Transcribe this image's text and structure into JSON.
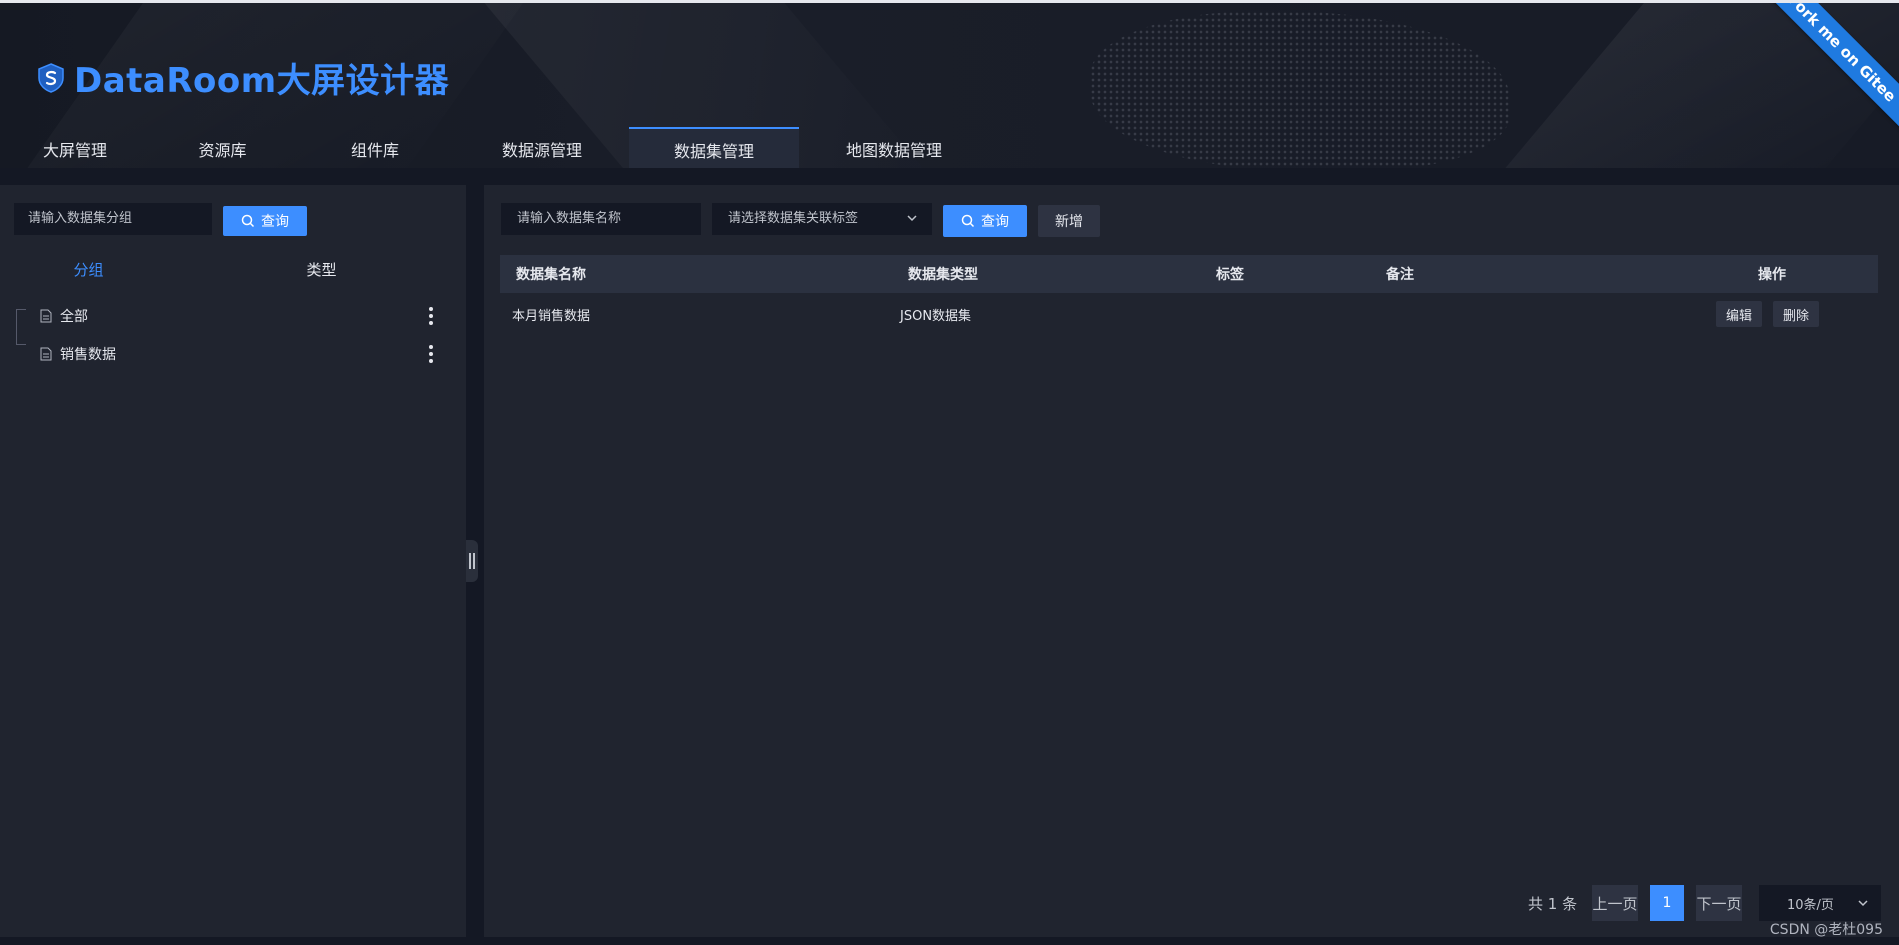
{
  "app": {
    "title": "DataRoom大屏设计器",
    "ribbon": "Fork me on Gitee",
    "brand_color": "#3d8eff"
  },
  "nav": {
    "items": [
      {
        "label": "大屏管理",
        "active": false
      },
      {
        "label": "资源库",
        "active": false
      },
      {
        "label": "组件库",
        "active": false
      },
      {
        "label": "数据源管理",
        "active": false
      },
      {
        "label": "数据集管理",
        "active": true
      },
      {
        "label": "地图数据管理",
        "active": false
      }
    ]
  },
  "left_panel": {
    "search_placeholder": "请输入数据集分组",
    "search_button": "查询",
    "tabs": [
      {
        "label": "分组",
        "active": true
      },
      {
        "label": "类型",
        "active": false
      }
    ],
    "tree": [
      {
        "label": "全部",
        "icon": "file-icon"
      },
      {
        "label": "销售数据",
        "icon": "file-icon"
      }
    ]
  },
  "right_panel": {
    "name_placeholder": "请输入数据集名称",
    "tag_placeholder": "请选择数据集关联标签",
    "search_button": "查询",
    "add_button": "新增",
    "table": {
      "columns": [
        "数据集名称",
        "数据集类型",
        "标签",
        "备注",
        "操作"
      ],
      "rows": [
        {
          "name": "本月销售数据",
          "type": "JSON数据集",
          "tags": "",
          "remark": "",
          "edit": "编辑",
          "delete": "删除"
        }
      ]
    },
    "pagination": {
      "total_text": "共 1 条",
      "prev": "上一页",
      "current": "1",
      "next": "下一页",
      "page_size": "10条/页"
    }
  },
  "watermark": "CSDN @老杜095"
}
